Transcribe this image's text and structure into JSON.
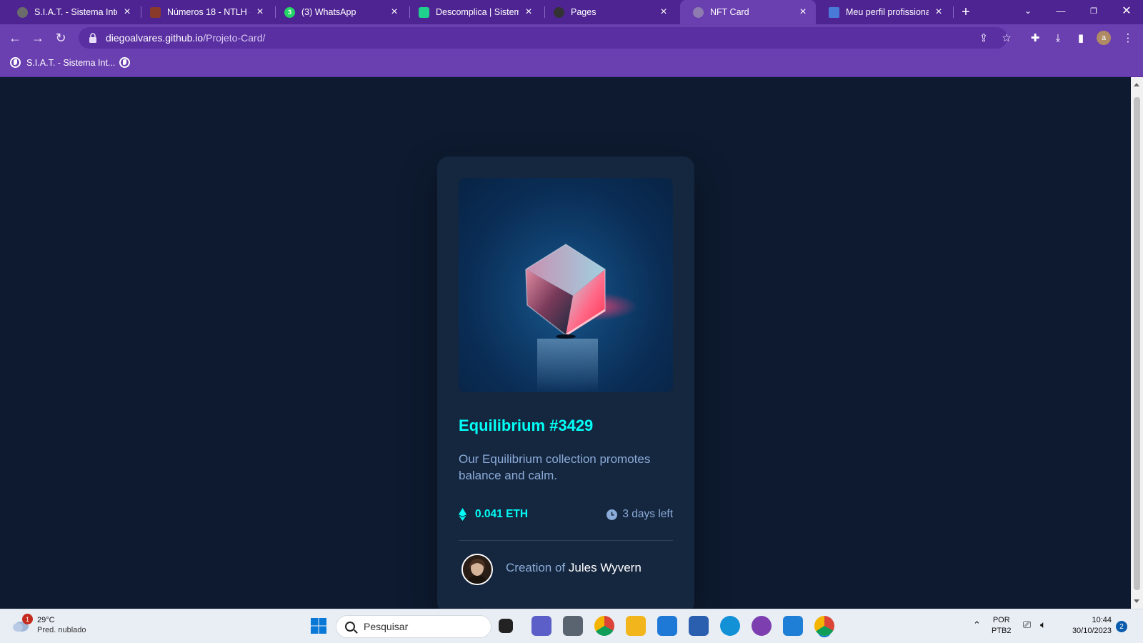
{
  "browser": {
    "tabs": [
      {
        "title": "S.I.A.T. - Sistema Integr",
        "icon": "globe-icon",
        "color": "#6b6b6b"
      },
      {
        "title": "Números 18 - NTLH - ",
        "icon": "book-icon",
        "color": "#8a3a2a"
      },
      {
        "title": "(3) WhatsApp",
        "icon": "whatsapp-icon",
        "color": "#25d366"
      },
      {
        "title": "Descomplica | Sistema",
        "icon": "descomplica-icon",
        "color": "#1fd18d"
      },
      {
        "title": "Pages",
        "icon": "github-icon",
        "color": "#333333"
      },
      {
        "title": "NFT Card",
        "icon": "globe-icon",
        "color": "#8e7cb0"
      },
      {
        "title": "Meu perfil profissional",
        "icon": "profile-page-icon",
        "color": "#4a7ad8"
      }
    ],
    "url_domain": "diegoalvares.github.io",
    "url_path": "/Projeto-Card/",
    "bookmark_label": "S.I.A.T. - Sistema Int...",
    "profile_initial": "a"
  },
  "card": {
    "title": "Equilibrium #3429",
    "description": "Our Equilibrium collection promotes balance and calm.",
    "price": "0.041 ETH",
    "time_left": "3 days left",
    "creator_prefix": "Creation of",
    "creator_name": "Jules Wyvern"
  },
  "taskbar": {
    "weather_temp": "29°C",
    "weather_desc": "Pred. nublado",
    "weather_badge": "1",
    "search_placeholder": "Pesquisar",
    "lang_top": "POR",
    "lang_bottom": "PTB2",
    "time": "10:44",
    "date": "30/10/2023",
    "notification_count": "2"
  },
  "colors": {
    "page_bg": "#0d1a2f",
    "card_bg": "#15263f",
    "accent_cyan": "#00fff7",
    "soft_blue": "#8bacd9",
    "browser_purple": "#6a3fb0"
  }
}
